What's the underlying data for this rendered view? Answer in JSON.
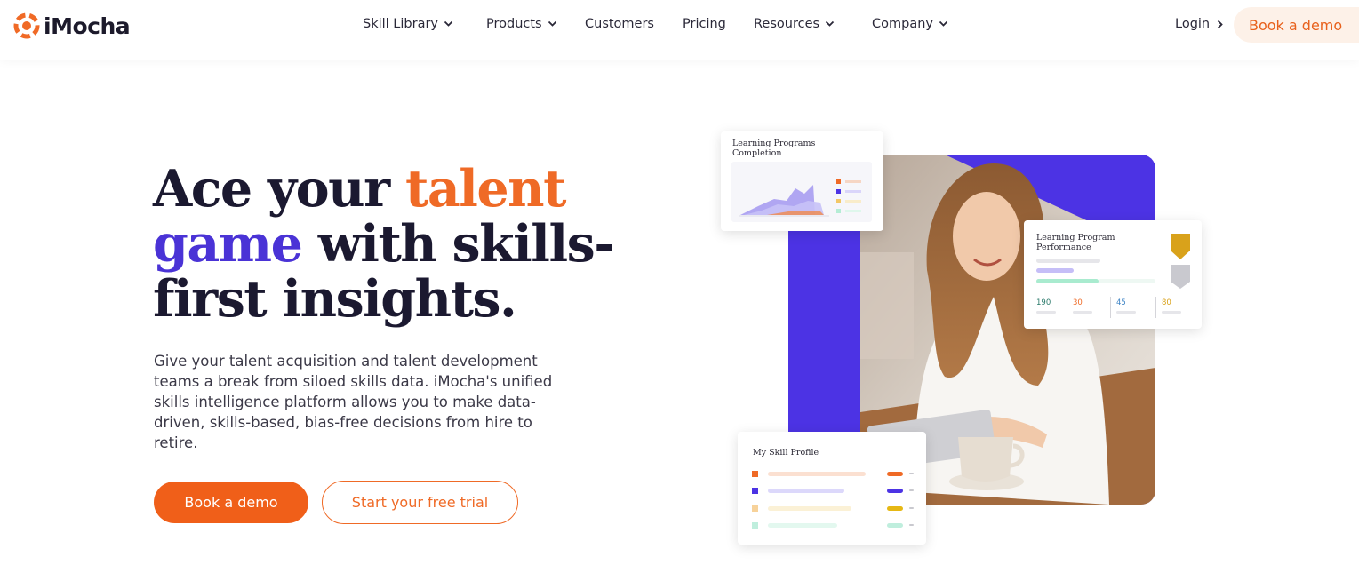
{
  "nav": {
    "logo_text": "iMocha",
    "items": [
      {
        "label": "Skill Library",
        "has_dropdown": true
      },
      {
        "label": "Products",
        "has_dropdown": true
      },
      {
        "label": "Customers",
        "has_dropdown": false
      },
      {
        "label": "Pricing",
        "has_dropdown": false
      },
      {
        "label": "Resources",
        "has_dropdown": true
      },
      {
        "label": "Company",
        "has_dropdown": true
      }
    ],
    "login_label": "Login",
    "cta_label": "Book a demo"
  },
  "hero": {
    "headline": {
      "part1": "Ace your ",
      "part2_accent_orange": "talent",
      "part3_accent_purple": "game",
      "part4": " with skills-",
      "part5": "first insights."
    },
    "description": "Give your talent acquisition and talent development teams a break from siloed skills data. iMocha's unified skills intelligence platform allows you to make data-driven, skills-based, bias-free decisions from hire to retire.",
    "primary_button": "Book a demo",
    "secondary_button": "Start your free trial"
  },
  "cards": {
    "learning_completion_title_line1": "Learning Programs",
    "learning_completion_title_line2": "Completion",
    "performance_title_line1": "Learning Program",
    "performance_title_line2": "Performance",
    "performance_stats": [
      "190",
      "30",
      "45",
      "80"
    ],
    "skill_profile_title": "My Skill Profile"
  },
  "colors": {
    "accent_orange": "#ef6a26",
    "accent_purple": "#4c33e4",
    "text_dark": "#1b1930"
  }
}
